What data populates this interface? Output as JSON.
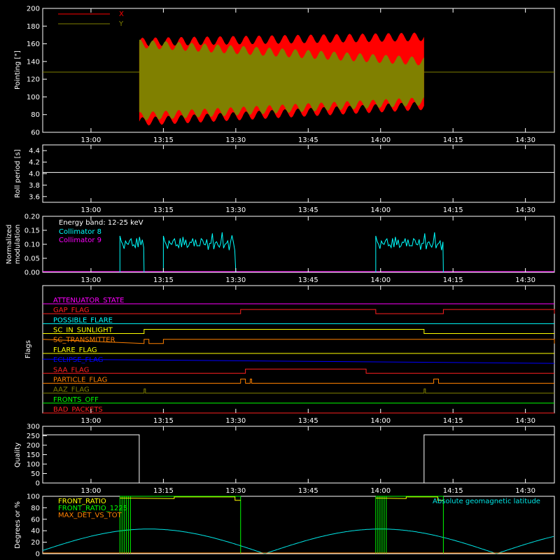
{
  "colors": {
    "background": "#000000",
    "axis": "#ffffff",
    "x_series": "#ff0000",
    "y_series": "#808000",
    "roll": "#ffffff",
    "coll8": "#00ffff",
    "coll9": "#ff00ff",
    "quality": "#ffffff",
    "front_ratio": "#ffff00",
    "front_ratio_1225": "#00ff00",
    "max_det": "#ff8000",
    "geomag": "#00e5e5"
  },
  "time_ticks": [
    "13:00",
    "13:15",
    "13:30",
    "13:45",
    "14:00",
    "14:15",
    "14:30"
  ],
  "chart_data": [
    {
      "type": "area",
      "ylabel": "Pointing [\"]",
      "ylim": [
        60,
        200
      ],
      "yticks": [
        "60",
        "80",
        "100",
        "120",
        "140",
        "160",
        "180",
        "200"
      ],
      "legend": [
        "X",
        "Y"
      ],
      "series": [
        {
          "name": "X",
          "start": "13:10",
          "end": "14:09",
          "envelope_start": [
            72,
            162
          ],
          "envelope_end": [
            90,
            168
          ]
        },
        {
          "name": "Y",
          "start": "13:10",
          "end": "14:09",
          "envelope_start": [
            78,
            160
          ],
          "envelope_end": [
            95,
            140
          ]
        }
      ],
      "baseline": 128
    },
    {
      "type": "line",
      "ylabel": "Roll period [s]",
      "ylim": [
        3.5,
        4.5
      ],
      "yticks": [
        "3.6",
        "3.8",
        "4.0",
        "4.2",
        "4.4"
      ],
      "value": 4.02
    },
    {
      "type": "line",
      "ylabel": "Normalized modulation",
      "ylim": [
        0,
        0.2
      ],
      "yticks": [
        "0.00",
        "0.05",
        "0.10",
        "0.15",
        "0.20"
      ],
      "annotation": "Energy band: 12-25 keV",
      "legend": [
        "Collimator 8",
        "Collimator 9"
      ],
      "segments": [
        {
          "start": "13:06",
          "end": "13:11",
          "level": 0.1
        },
        {
          "start": "13:15",
          "end": "13:30",
          "level": 0.1
        },
        {
          "start": "13:59",
          "end": "14:13",
          "level": 0.1
        }
      ]
    },
    {
      "type": "line",
      "ylabel": "Flags",
      "flags": [
        "ATTENUATOR_STATE",
        "GAP_FLAG",
        "POSSIBLE_FLARE",
        "SC_IN_SUNLIGHT",
        "SC_TRANSMITTER",
        "FLARE_FLAG",
        "ECLIPSE_FLAG",
        "SAA_FLAG",
        "PARTICLE_FLAG",
        "AAZ_FLAG",
        "FRONTS_OFF",
        "BAD_PACKETS"
      ],
      "flag_colors": [
        "#ff00ff",
        "#ff2020",
        "#00ffff",
        "#ffff00",
        "#ff8000",
        "#ffff00",
        "#0000ff",
        "#ff2020",
        "#ff8000",
        "#808000",
        "#00ff00",
        "#ff2020"
      ]
    },
    {
      "type": "line",
      "ylabel": "Quality",
      "ylim": [
        0,
        300
      ],
      "yticks": [
        "0",
        "50",
        "100",
        "150",
        "200",
        "250",
        "300"
      ],
      "segments": [
        {
          "start": "12:50",
          "end": "13:10",
          "value": 255
        },
        {
          "start": "13:10",
          "end": "14:09",
          "value": 0
        },
        {
          "start": "14:09",
          "end": "14:36",
          "value": 255
        }
      ]
    },
    {
      "type": "line",
      "ylabel": "Degrees or %",
      "ylim": [
        0,
        100
      ],
      "yticks": [
        "0",
        "20",
        "40",
        "60",
        "80",
        "100"
      ],
      "legend": [
        "FRONT_RATIO",
        "FRONT_RATIO_1225",
        "MAX_DET_VS_TOT",
        "Absolute geomagnetic latitude"
      ],
      "geomag_latitude": {
        "peak": 43,
        "peaks_at": [
          "13:12",
          "14:00"
        ],
        "zeros_at": [
          "13:36",
          "14:24"
        ]
      }
    }
  ]
}
